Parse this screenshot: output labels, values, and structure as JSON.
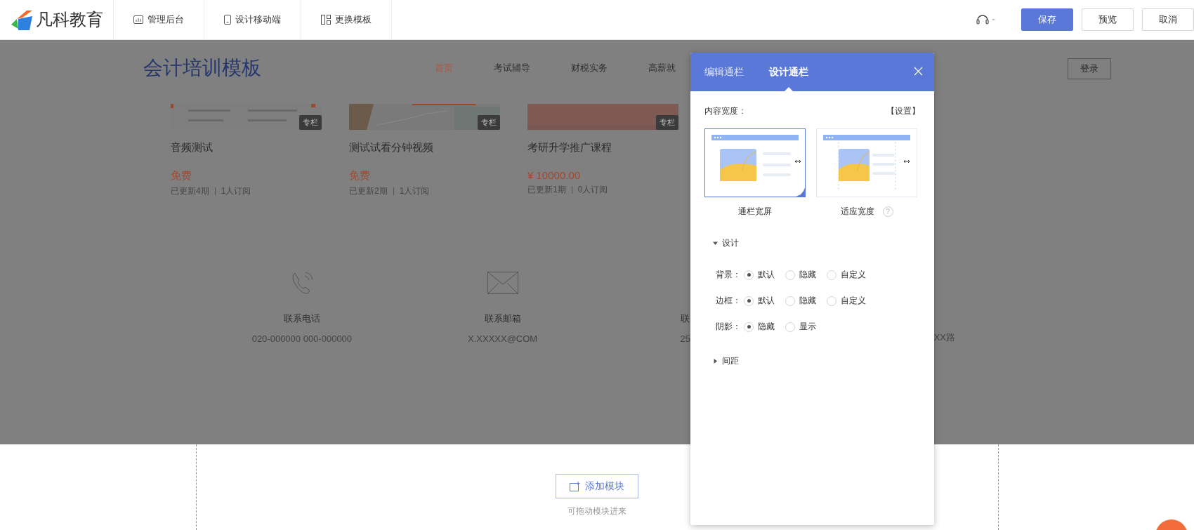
{
  "topbar": {
    "logo": "凡科教育",
    "nav": [
      {
        "label": "管理后台",
        "kind": "chart"
      },
      {
        "label": "设计移动端",
        "kind": "mobile"
      },
      {
        "label": "更换模板",
        "kind": "layout"
      }
    ],
    "actions": [
      {
        "label": "保存",
        "kind": "primary"
      },
      {
        "label": "预览",
        "kind": "default"
      },
      {
        "label": "取消",
        "kind": "default"
      }
    ]
  },
  "site": {
    "title": "会计培训模板",
    "nav": [
      {
        "label": "首页",
        "selected": true
      },
      {
        "label": "考试辅导",
        "selected": false
      },
      {
        "label": "财税实务",
        "selected": false
      },
      {
        "label": "高薪就",
        "selected": false
      }
    ],
    "login": "登录",
    "courses": [
      {
        "badge": "专栏",
        "title": "音频测试",
        "price": "免费",
        "updates": "已更新4期",
        "subscribers": "1人订阅"
      },
      {
        "badge": "专栏",
        "title": "测试试看分钟视频",
        "price": "免费",
        "updates": "已更新2期",
        "subscribers": "1人订阅"
      },
      {
        "badge": "专栏",
        "title": "考研升学推广课程",
        "price": "¥ 10000.00",
        "updates": "已更新1期",
        "subscribers": "0人订阅"
      }
    ],
    "contacts": [
      {
        "kind": "phone",
        "label": "联系电话",
        "value": "020-000000 000-000000"
      },
      {
        "kind": "mail",
        "label": "联系邮箱",
        "value": "X.XXXXX@COM"
      },
      {
        "kind": "none",
        "label": "联",
        "value": "25"
      },
      {
        "kind": "none",
        "value": "XX路"
      }
    ]
  },
  "dropzone": {
    "button": "添加模块",
    "hint": "可拖动模块进来"
  },
  "panel": {
    "tabs": [
      {
        "label": "编辑通栏",
        "selected": false
      },
      {
        "label": "设计通栏",
        "selected": true
      }
    ],
    "width_label": "内容宽度：",
    "settings_link": "【设置】",
    "width_options": [
      {
        "kind": "full",
        "label": "通栏宽屏",
        "selected": true
      },
      {
        "kind": "fit",
        "label": "适应宽度",
        "selected": false,
        "help": "?"
      }
    ],
    "sections": [
      {
        "title": "设计",
        "expanded": true,
        "fields": [
          {
            "label": "背景：",
            "options": [
              {
                "label": "默认",
                "selected": true
              },
              {
                "label": "隐藏",
                "selected": false
              },
              {
                "label": "自定义",
                "selected": false
              }
            ]
          },
          {
            "label": "边框：",
            "options": [
              {
                "label": "默认",
                "selected": true
              },
              {
                "label": "隐藏",
                "selected": false
              },
              {
                "label": "自定义",
                "selected": false
              }
            ]
          },
          {
            "label": "阴影：",
            "options": [
              {
                "label": "隐藏",
                "selected": true
              },
              {
                "label": "显示",
                "selected": false
              }
            ]
          }
        ]
      },
      {
        "title": "间距",
        "expanded": false
      }
    ]
  }
}
